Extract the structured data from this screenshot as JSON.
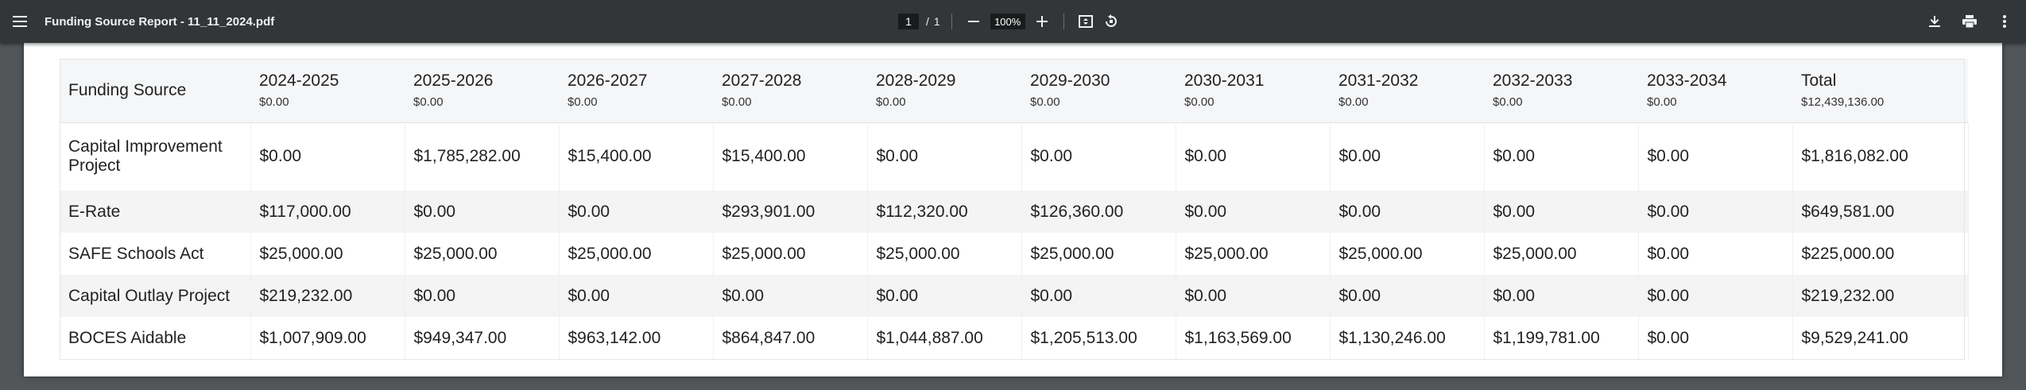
{
  "toolbar": {
    "title": "Funding Source Report - 11_11_2024.pdf",
    "current_page": "1",
    "page_separator": "/",
    "total_pages": "1",
    "zoom": "100%"
  },
  "table": {
    "header": {
      "label": "Funding Source",
      "columns": [
        {
          "year": "2024-2025",
          "total": "$0.00"
        },
        {
          "year": "2025-2026",
          "total": "$0.00"
        },
        {
          "year": "2026-2027",
          "total": "$0.00"
        },
        {
          "year": "2027-2028",
          "total": "$0.00"
        },
        {
          "year": "2028-2029",
          "total": "$0.00"
        },
        {
          "year": "2029-2030",
          "total": "$0.00"
        },
        {
          "year": "2030-2031",
          "total": "$0.00"
        },
        {
          "year": "2031-2032",
          "total": "$0.00"
        },
        {
          "year": "2032-2033",
          "total": "$0.00"
        },
        {
          "year": "2033-2034",
          "total": "$0.00"
        },
        {
          "year": "Total",
          "total": "$12,439,136.00"
        }
      ]
    },
    "rows": [
      {
        "source": "Capital Improvement Project",
        "values": [
          "$0.00",
          "$1,785,282.00",
          "$15,400.00",
          "$15,400.00",
          "$0.00",
          "$0.00",
          "$0.00",
          "$0.00",
          "$0.00",
          "$0.00",
          "$1,816,082.00"
        ]
      },
      {
        "source": "E-Rate",
        "values": [
          "$117,000.00",
          "$0.00",
          "$0.00",
          "$293,901.00",
          "$112,320.00",
          "$126,360.00",
          "$0.00",
          "$0.00",
          "$0.00",
          "$0.00",
          "$649,581.00"
        ]
      },
      {
        "source": "SAFE Schools Act",
        "values": [
          "$25,000.00",
          "$25,000.00",
          "$25,000.00",
          "$25,000.00",
          "$25,000.00",
          "$25,000.00",
          "$25,000.00",
          "$25,000.00",
          "$25,000.00",
          "$0.00",
          "$225,000.00"
        ]
      },
      {
        "source": "Capital Outlay Project",
        "values": [
          "$219,232.00",
          "$0.00",
          "$0.00",
          "$0.00",
          "$0.00",
          "$0.00",
          "$0.00",
          "$0.00",
          "$0.00",
          "$0.00",
          "$219,232.00"
        ]
      },
      {
        "source": "BOCES Aidable",
        "values": [
          "$1,007,909.00",
          "$949,347.00",
          "$963,142.00",
          "$864,847.00",
          "$1,044,887.00",
          "$1,205,513.00",
          "$1,163,569.00",
          "$1,130,246.00",
          "$1,199,781.00",
          "$0.00",
          "$9,529,241.00"
        ]
      }
    ]
  },
  "icons": {
    "menu": "menu-icon",
    "zoom_out": "minus-icon",
    "zoom_in": "plus-icon",
    "fit": "fit-page-icon",
    "rotate": "rotate-icon",
    "download": "download-icon",
    "print": "print-icon",
    "more": "more-vert-icon"
  }
}
